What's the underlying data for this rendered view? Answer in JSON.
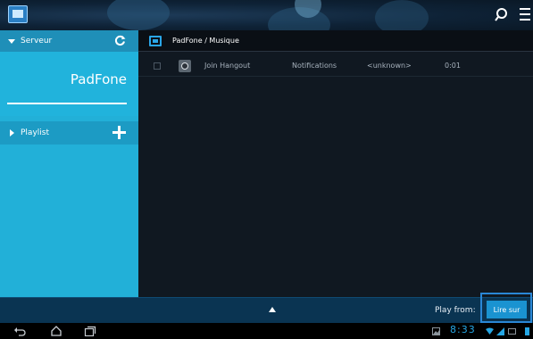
{
  "sidebar": {
    "server_label": "Serveur",
    "device_name": "PadFone",
    "playlist_label": "Playlist"
  },
  "main": {
    "breadcrumb": "PadFone / Musique",
    "tracks": [
      {
        "title": "Join Hangout",
        "album": "Notifications",
        "artist": "<unknown>",
        "duration": "0:01"
      }
    ]
  },
  "controls": {
    "play_from_label": "Play from:",
    "cast_button_label": "Lire sur"
  },
  "system": {
    "clock": "8:33"
  },
  "icons": {
    "app": "app-icon",
    "search": "search-icon",
    "menu": "overflow-menu-icon",
    "refresh": "refresh-icon",
    "add": "plus-icon",
    "folder": "folder-icon",
    "track": "music-track-icon",
    "expand": "expand-up-icon",
    "back": "back-icon",
    "home": "home-icon",
    "recents": "recent-apps-icon"
  },
  "colors": {
    "accent": "#22b0d8",
    "button": "#1a93d1",
    "clock": "#26a6e4"
  }
}
